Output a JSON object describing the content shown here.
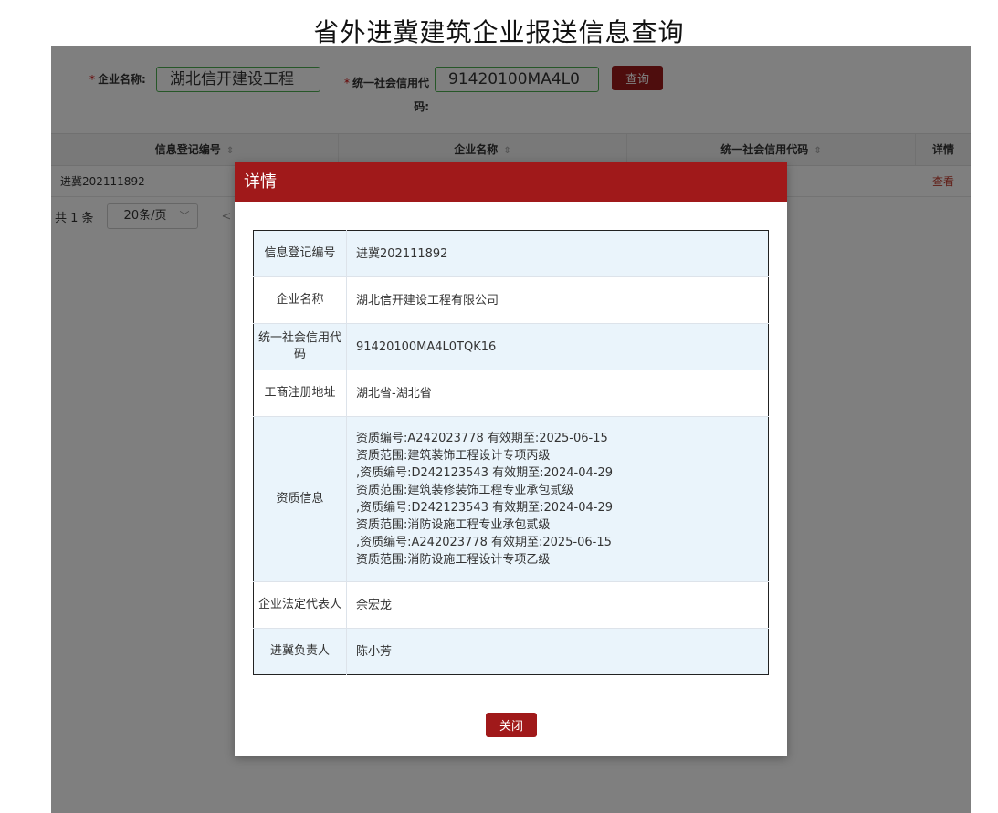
{
  "page_title": "省外进冀建筑企业报送信息查询",
  "search": {
    "name_label": "企业名称:",
    "name_value": "湖北信开建设工程",
    "credit_label": "统一社会信用代码:",
    "credit_value": "91420100MA4L0",
    "query_button": "查询",
    "required_mark": "*"
  },
  "table": {
    "columns": [
      "信息登记编号",
      "企业名称",
      "统一社会信用代码",
      "详情"
    ],
    "rows": [
      {
        "reg_no": "进冀202111892",
        "company": "",
        "credit": "",
        "detail_link": "查看"
      }
    ]
  },
  "pager": {
    "total": "共 1 条",
    "page_size": "20条/页",
    "prev": "<"
  },
  "modal": {
    "title": "详情",
    "fields": [
      {
        "key": "信息登记编号",
        "value": "进冀202111892"
      },
      {
        "key": "企业名称",
        "value": "湖北信开建设工程有限公司"
      },
      {
        "key": "统一社会信用代码",
        "value": "91420100MA4L0TQK16"
      },
      {
        "key": "工商注册地址",
        "value": "湖北省-湖北省"
      },
      {
        "key": "资质信息",
        "lines": [
          "资质编号:A242023778 有效期至:2025-06-15",
          "资质范围:建筑装饰工程设计专项丙级",
          ",资质编号:D242123543 有效期至:2024-04-29",
          "资质范围:建筑装修装饰工程专业承包贰级",
          ",资质编号:D242123543 有效期至:2024-04-29",
          "资质范围:消防设施工程专业承包贰级",
          ",资质编号:A242023778 有效期至:2025-06-15",
          "资质范围:消防设施工程设计专项乙级"
        ]
      },
      {
        "key": "企业法定代表人",
        "value": "余宏龙"
      },
      {
        "key": "进冀负责人",
        "value": "陈小芳"
      }
    ],
    "close_button": "关闭"
  },
  "colors": {
    "brand_red": "#a0191a",
    "row_alt": "#eaf4fb",
    "input_border": "#4caf50"
  }
}
